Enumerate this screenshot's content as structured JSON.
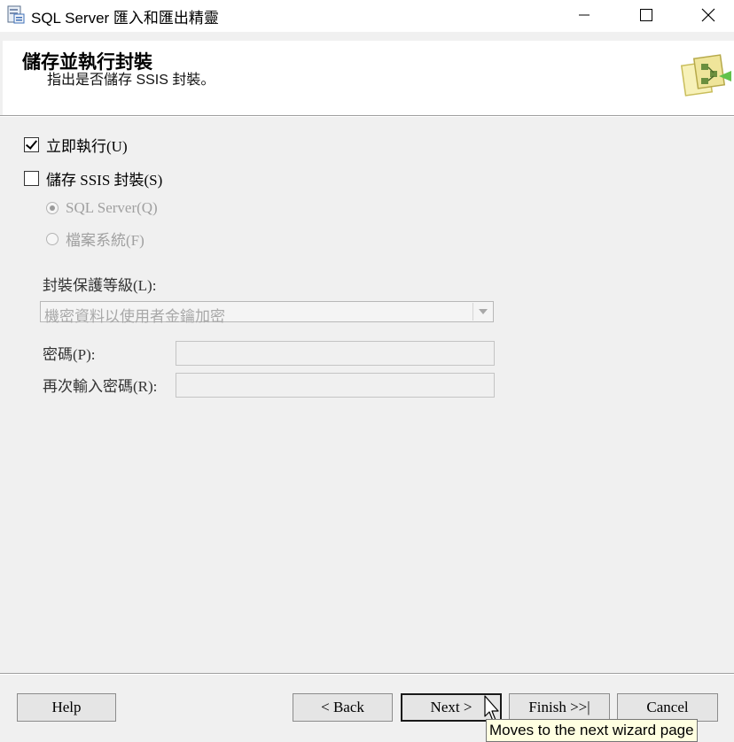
{
  "window": {
    "title": "SQL Server 匯入和匯出精靈",
    "icons": {
      "app": "wizard-app-icon",
      "minimize": "minimize-icon",
      "maximize": "maximize-icon",
      "close": "close-icon"
    }
  },
  "header": {
    "title": "儲存並執行封裝",
    "subtitle": "指出是否儲存 SSIS 封裝。",
    "art_icon": "package-art-icon"
  },
  "options": {
    "run_immediately": {
      "label": "立即執行(U)",
      "checked": true
    },
    "save_ssis": {
      "label": "儲存 SSIS 封裝(S)",
      "checked": false
    },
    "save_target": [
      {
        "label": "SQL Server(Q)",
        "selected": true,
        "enabled": false
      },
      {
        "label": "檔案系統(F)",
        "selected": false,
        "enabled": false
      }
    ]
  },
  "protection": {
    "label": "封裝保護等級(L):",
    "selected_value": "機密資料以使用者金鑰加密",
    "enabled": false
  },
  "password": {
    "label": "密碼(P):",
    "value": "",
    "retype_label": "再次輸入密碼(R):",
    "retype_value": ""
  },
  "buttons": {
    "help": "Help",
    "back": "< Back",
    "next": "Next >",
    "finish": "Finish >>|",
    "cancel": "Cancel"
  },
  "tooltip": {
    "text": "Moves to the next wizard page"
  },
  "colors": {
    "disabled_text": "#a0a0a0",
    "tooltip_bg": "#ffffe1",
    "window_bg": "#f0f0f0"
  }
}
